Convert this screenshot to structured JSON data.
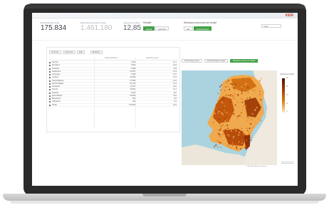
{
  "header": {
    "logo": "KEN"
  },
  "kpis": [
    {
      "label": "Bedrijfsaantal totaal",
      "value": "175.834",
      "style": "dark"
    },
    {
      "label": "Werkzame personen totaal",
      "value": "1.461.180",
      "style": "light"
    },
    {
      "label": "Aantal per bedrijf",
      "value": "12,85",
      "style": "mid"
    }
  ],
  "controls": {
    "toggle_a": {
      "label": "Relatief",
      "options": [
        "aantal",
        "aandeel"
      ],
      "selected": "aantal"
    },
    "toggle_b": {
      "label": "Werkzame personen per bedrijf",
      "options": [
        "alle",
        "geselecteerd"
      ],
      "selected": "geselecteerd"
    },
    "search_placeholder": "Zoek"
  },
  "table": {
    "filters": [
      "Provincie",
      "Gemeente",
      "Wijk"
    ],
    "header_label": "Bedrijven",
    "columns": [
      "aantal bedrijven",
      "werkzame pers."
    ],
    "rows": [
      {
        "name": "Drenthe",
        "v1": "3.785",
        "v2": "12,1"
      },
      {
        "name": "Flevoland",
        "v1": "2.915",
        "v2": "12,8"
      },
      {
        "name": "Friesland",
        "v1": "6.086",
        "v2": "11,6"
      },
      {
        "name": "Gelderland",
        "v1": "20.687",
        "v2": "12,9"
      },
      {
        "name": "Groningen",
        "v1": "5.238",
        "v2": "13,3"
      },
      {
        "name": "Limburg",
        "v1": "10.485",
        "v2": "12,4"
      },
      {
        "name": "Noord-Brabant",
        "v1": "27.562",
        "v2": "13,5"
      },
      {
        "name": "Noord-Holland",
        "v1": "32.733",
        "v2": "13,1"
      },
      {
        "name": "Overijssel",
        "v1": "11.027",
        "v2": "13,0"
      },
      {
        "name": "Utrecht",
        "v1": "13.891",
        "v2": "12,7"
      },
      {
        "name": "Zeeland",
        "v1": "4.224",
        "v2": "11,0"
      },
      {
        "name": "Zuid-Holland",
        "v1": "36.892",
        "v2": "13,0"
      },
      {
        "name": "Buitenland",
        "v1": "184",
        "v2": "9,8"
      },
      {
        "name": "Onbekend",
        "v1": "135",
        "v2": "8,1"
      },
      {
        "name": "Totaal",
        "v1": "175.834",
        "v2": "12,9"
      }
    ]
  },
  "map_panel": {
    "tabs": [
      "Percentage (cum)",
      "Aantal bedrijven (wijk)",
      "Werkzame pers. per bedrijf"
    ],
    "active_tab": 2,
    "legend_title": "Aantal per bedrijf",
    "legend_ticks": [
      "48",
      "36",
      "24",
      "12",
      "0"
    ],
    "attribution": "© OpenStreetMap contributors",
    "colors": {
      "water": "#aad3df",
      "land": "#efe9df",
      "high": "#8e3205",
      "low": "#f4b35b"
    }
  }
}
